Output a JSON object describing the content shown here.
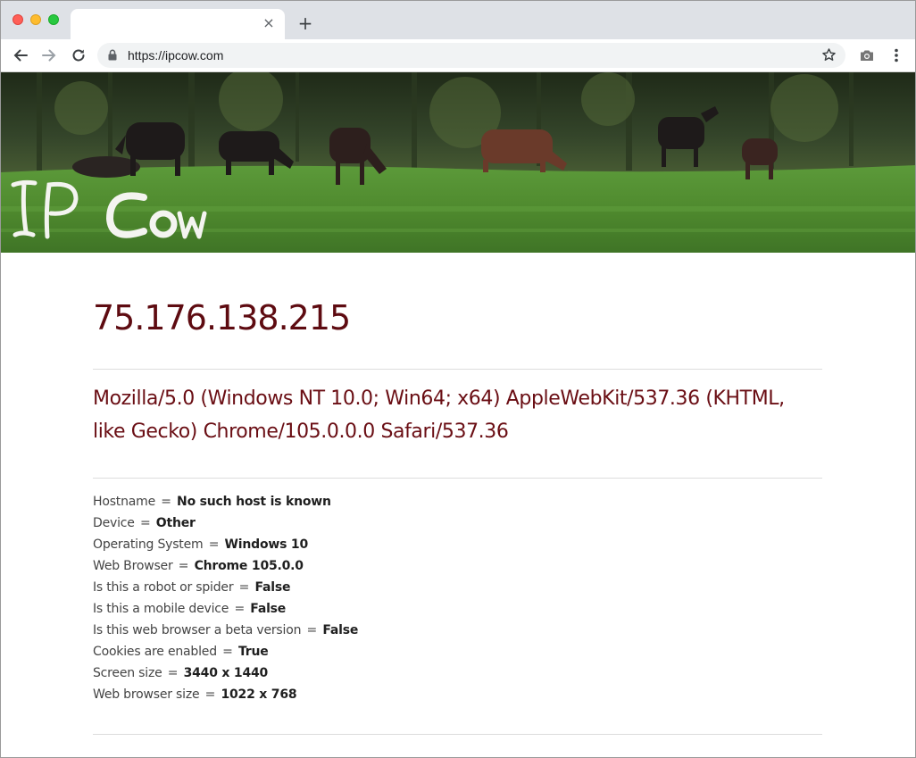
{
  "browser": {
    "tab_close": "×",
    "new_tab": "+",
    "url": "https://ipcow.com"
  },
  "banner": {
    "logo_text": "IP Cow"
  },
  "main": {
    "ip_address": "75.176.138.215",
    "user_agent": "Mozilla/5.0 (Windows NT 10.0; Win64; x64) AppleWebKit/537.36 (KHTML, like Gecko) Chrome/105.0.0.0 Safari/537.36",
    "separator": "=",
    "details": [
      {
        "label": "Hostname",
        "value": "No such host is known"
      },
      {
        "label": "Device",
        "value": "Other"
      },
      {
        "label": "Operating System",
        "value": "Windows 10"
      },
      {
        "label": "Web Browser",
        "value": "Chrome 105.0.0"
      },
      {
        "label": "Is this a robot or spider",
        "value": "False"
      },
      {
        "label": "Is this a mobile device",
        "value": "False"
      },
      {
        "label": "Is this web browser a beta version",
        "value": "False"
      },
      {
        "label": "Cookies are enabled",
        "value": "True"
      },
      {
        "label": "Screen size",
        "value": "3440 x 1440"
      },
      {
        "label": "Web browser size",
        "value": "1022 x 768"
      }
    ]
  },
  "colors": {
    "accent": "#5e0b11",
    "grass": "#4f8a2e",
    "trees": "#2b3a22"
  },
  "icons": [
    "close-icon",
    "back-arrow-icon",
    "forward-arrow-icon",
    "reload-icon",
    "lock-icon",
    "star-icon",
    "camera-icon",
    "more-menu-icon"
  ]
}
